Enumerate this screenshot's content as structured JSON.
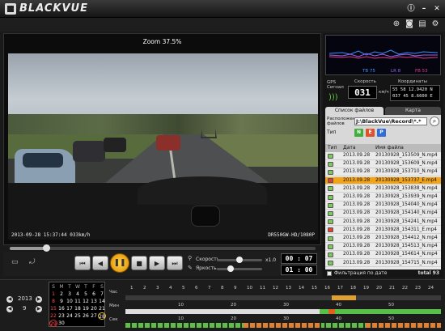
{
  "app": {
    "brand": "BLACKVUE"
  },
  "video": {
    "zoom_text": "Zoom 37.5%",
    "overlay_time": "2013-09-28  15:37:44   033km/h",
    "overlay_model": "DR550GW-HD/1080P"
  },
  "player": {
    "seek_fraction": 0.12,
    "speed_label": "Скорость",
    "speed_value": "x1.0",
    "speed_fraction": 0.5,
    "brightness_label": "Яркость",
    "brightness_fraction": 0.3,
    "time_current": "00 : 07",
    "time_total": "01 : 00"
  },
  "gsensor": {
    "legend": [
      "TB 75",
      "LR 8",
      "FB 53"
    ]
  },
  "gps": {
    "gps_label": "GPS Сигнал",
    "speed_label": "Скорость",
    "speed_value": "031",
    "speed_unit": "км/ч",
    "coords_label": "Координаты",
    "lat": "55   58   12.9420 N",
    "lon": "037   45   8.6600 E"
  },
  "tabs": {
    "files": "Список файлов",
    "map": "Карта"
  },
  "fileopts": {
    "location_label": "Расположение файлов",
    "path": "J:\\BlackVue\\Record\\*.*",
    "type_label": "Тип",
    "types": [
      "N",
      "E",
      "P"
    ]
  },
  "table": {
    "headers": {
      "type": "Тип",
      "date": "Дата",
      "name": "Имя файла"
    },
    "rows": [
      {
        "date": "2013.09.28",
        "name": "20130928_153509_N.mp4",
        "color": "#7cc85a",
        "selected": false
      },
      {
        "date": "2013.09.28",
        "name": "20130928_153609_N.mp4",
        "color": "#7cc85a",
        "selected": false
      },
      {
        "date": "2013.09.28",
        "name": "20130928_153710_N.mp4",
        "color": "#7cc85a",
        "selected": false
      },
      {
        "date": "2013.09.28",
        "name": "20130928_153737_E.mp4",
        "color": "#e04030",
        "selected": true
      },
      {
        "date": "2013.09.28",
        "name": "20130928_153838_N.mp4",
        "color": "#7cc85a",
        "selected": false
      },
      {
        "date": "2013.09.28",
        "name": "20130928_153939_N.mp4",
        "color": "#7cc85a",
        "selected": false
      },
      {
        "date": "2013.09.28",
        "name": "20130928_154040_N.mp4",
        "color": "#7cc85a",
        "selected": false
      },
      {
        "date": "2013.09.28",
        "name": "20130928_154140_N.mp4",
        "color": "#7cc85a",
        "selected": false
      },
      {
        "date": "2013.09.28",
        "name": "20130928_154241_N.mp4",
        "color": "#7cc85a",
        "selected": false
      },
      {
        "date": "2013.09.28",
        "name": "20130928_154311_E.mp4",
        "color": "#e04030",
        "selected": false
      },
      {
        "date": "2013.09.28",
        "name": "20130928_154412_N.mp4",
        "color": "#7cc85a",
        "selected": false
      },
      {
        "date": "2013.09.28",
        "name": "20130928_154513_N.mp4",
        "color": "#7cc85a",
        "selected": false
      },
      {
        "date": "2013.09.28",
        "name": "20130928_154614_N.mp4",
        "color": "#7cc85a",
        "selected": false
      },
      {
        "date": "2013.09.28",
        "name": "20130928_154715_N.mp4",
        "color": "#7cc85a",
        "selected": false
      }
    ]
  },
  "filter": {
    "label": "Фильтрация по дате",
    "total": "total 93"
  },
  "calendar": {
    "year": "2013",
    "month": "9",
    "weekdays": [
      "S",
      "M",
      "T",
      "W",
      "T",
      "F",
      "S"
    ],
    "days": [
      [
        "1",
        "2",
        "3",
        "4",
        "5",
        "6",
        "7"
      ],
      [
        "8",
        "9",
        "10",
        "11",
        "12",
        "13",
        "14"
      ],
      [
        "15",
        "16",
        "17",
        "18",
        "19",
        "20",
        "21"
      ],
      [
        "22",
        "23",
        "24",
        "25",
        "26",
        "27",
        "28"
      ],
      [
        "29",
        "30",
        "",
        "",
        "",
        "",
        ""
      ]
    ]
  },
  "timeline": {
    "row_labels": [
      "Час",
      "Мин",
      "Сек"
    ],
    "hour_ticks": [
      "1",
      "2",
      "3",
      "4",
      "5",
      "6",
      "7",
      "8",
      "9",
      "10",
      "11",
      "12",
      "13",
      "14",
      "15",
      "16",
      "17",
      "18",
      "19",
      "20",
      "21",
      "22",
      "23",
      "24"
    ],
    "minute_ticks": [
      "10",
      "20",
      "30",
      "40",
      "50"
    ],
    "second_ticks": [
      "10",
      "20",
      "30",
      "40",
      "50"
    ]
  }
}
